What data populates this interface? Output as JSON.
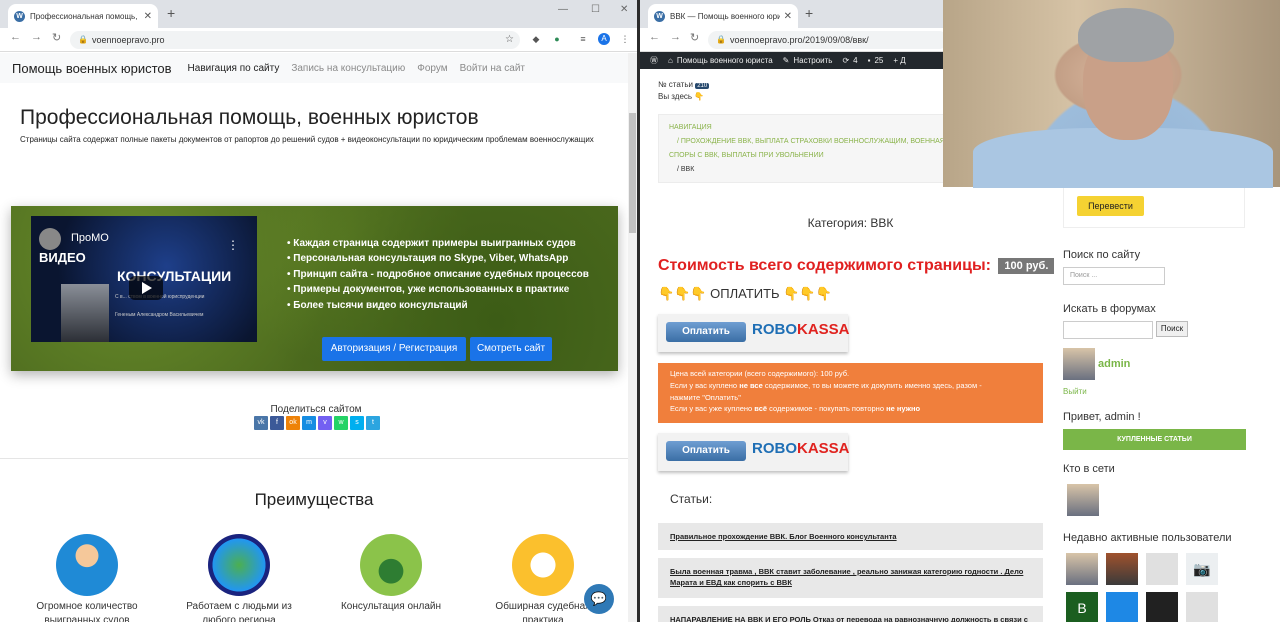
{
  "left": {
    "tab_title": "Профессиональная помощь, в...",
    "url": "voennoepravo.pro",
    "brand": "Помощь военных юристов",
    "nav": [
      "Навигация по сайту",
      "Запись на консультацию",
      "Форум",
      "Войти на сайт"
    ],
    "hero_title": "Профессиональная помощь, военных юристов",
    "hero_text": "Страницы сайта содержат полные пакеты документов от рапортов до решений судов + видеоконсультации по юридическим проблемам военнослужащих",
    "video": {
      "channel": "ПроМО",
      "line1": "ВИДЕО",
      "line2": "КОНСУЛЬТАЦИИ",
      "caption": "С в...             ством в военной юриспруденции",
      "author": "Гененым Александром Васильевичем"
    },
    "bullets": [
      "Каждая страница содержит примеры выигранных судов",
      "Персональная консультация по Skype, Viber, WhatsApp",
      "Принцип сайта - подробное описание судебных процессов",
      "Примеры документов, уже использованных в практике",
      "Более тысячи видео консультаций"
    ],
    "btn_auth": "Авторизация / Регистрация",
    "btn_view": "Смотреть сайт",
    "share_label": "Поделиться сайтом",
    "share_icons": [
      "vk",
      "f",
      "ok",
      "m",
      "v",
      "w",
      "s",
      "t"
    ],
    "advantages_title": "Преимущества",
    "features": [
      "Огромное количество выигранных судов",
      "Работаем с людьми из любого региона",
      "Консультация онлайн",
      "Обширная судебная практика"
    ]
  },
  "right": {
    "tab_title": "ВВК — Помощь военного юрис...",
    "url": "voennoepravo.pro/2019/09/08/ввк/",
    "wpbar": {
      "site": "Помощь военного юриста",
      "customize": "Настроить",
      "updates": "4",
      "comments": "25",
      "add": "+ Д"
    },
    "article_no_label": "№ статьи",
    "article_no": "210",
    "you_are_here": "Вы здесь 👇",
    "crumbs": {
      "title": "НАВИГАЦИЯ",
      "line1": "/ ПРОХОЖДЕНИЕ ВВК, ВЫПЛАТА СТРАХОВКИ ВОЕННОСЛУЖАЩИМ, ВОЕННАЯ Т...",
      "line2": "СПОРЫ С ВВК, ВЫПЛАТЫ ПРИ УВОЛЬНЕНИИ",
      "current": "/ ВВК"
    },
    "category": "Категория: ВВК",
    "price_label": "Стоимость всего содержимого страницы:",
    "price": "100 руб.",
    "pay_label": "👇👇👇 ОПЛАТИТЬ 👇👇👇",
    "pay_button": "Оплатить",
    "robo": "ROBO",
    "kassa": "KASSA",
    "notice": {
      "line1": "Цена всей категории (всего содержимого): 100 руб.",
      "line2a": "Если у вас куплено ",
      "line2b": "не все",
      "line2c": " содержимое, то вы можете их докупить именно здесь, разом -",
      "line3": "нажмите \"Оплатить\"",
      "line4a": "Если у вас уже куплено ",
      "line4b": "всё",
      "line4c": " содержимое - покупать повторно ",
      "line4d": "не нужно"
    },
    "articles_label": "Статьи:",
    "articles": [
      "Правильное прохождение ВВК. Блог Военного консультанта",
      "Была военная травма , ВВК ставит заболевание , реально занижая категорию годности . Дело Марата и ЕВД как спорить с ВВК",
      "НАПАРАВЛЕНИЕ НА ВВК И ЕГО РОЛЬ Отказ от перевода на равнозначную должность в связи с"
    ],
    "sidebar": {
      "translate": "Перевести",
      "search_title": "Поиск по сайту",
      "search_placeholder": "Поиск ...",
      "forum_title": "Искать в форумах",
      "forum_button": "Поиск",
      "user": "admin",
      "logout": "Выйти",
      "greeting": "Привет, admin !",
      "bought": "КУПЛЕННЫЕ СТАТЬИ",
      "online": "Кто в сети",
      "recent": "Недавно активные пользователи",
      "avatar_letter": "B"
    }
  }
}
